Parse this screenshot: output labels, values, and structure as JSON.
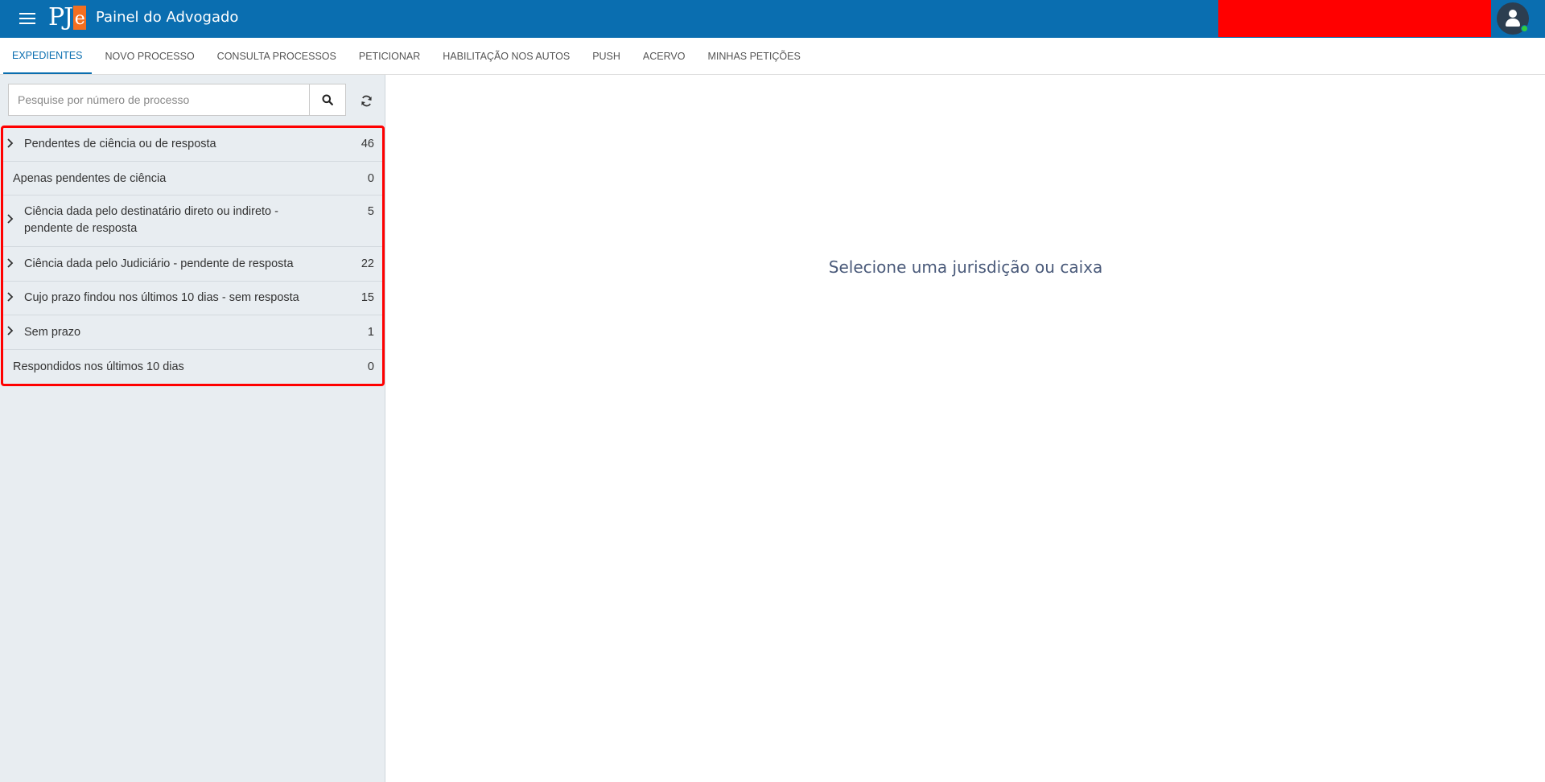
{
  "header": {
    "logo_text": "PJ",
    "logo_e": "e",
    "title": "Painel do Advogado",
    "brand_color": "#0a6eb0",
    "logo_accent": "#f36f21"
  },
  "tabs": [
    {
      "label": "EXPEDIENTES",
      "active": true
    },
    {
      "label": "NOVO PROCESSO"
    },
    {
      "label": "CONSULTA PROCESSOS"
    },
    {
      "label": "PETICIONAR"
    },
    {
      "label": "HABILITAÇÃO NOS AUTOS"
    },
    {
      "label": "PUSH"
    },
    {
      "label": "ACERVO"
    },
    {
      "label": "MINHAS PETIÇÕES"
    }
  ],
  "search": {
    "placeholder": "Pesquise por número de processo",
    "value": ""
  },
  "icons": {
    "menu": "menu-icon",
    "search": "search-icon",
    "refresh": "refresh-icon",
    "avatar": "user-icon",
    "chevron": "chevron-right-icon"
  },
  "expedientes": [
    {
      "label": "Pendentes de ciência ou de resposta",
      "count": "46",
      "expandable": true
    },
    {
      "label": "Apenas pendentes de ciência",
      "count": "0",
      "expandable": false
    },
    {
      "label": "Ciência dada pelo destinatário direto ou indireto - pendente de resposta",
      "count": "5",
      "expandable": true
    },
    {
      "label": "Ciência dada pelo Judiciário - pendente de resposta",
      "count": "22",
      "expandable": true
    },
    {
      "label": "Cujo prazo findou nos últimos 10 dias - sem resposta",
      "count": "15",
      "expandable": true
    },
    {
      "label": "Sem prazo",
      "count": "1",
      "expandable": true
    },
    {
      "label": "Respondidos nos últimos 10 dias",
      "count": "0",
      "expandable": false
    }
  ],
  "main": {
    "empty_message": "Selecione uma jurisdição ou caixa"
  }
}
